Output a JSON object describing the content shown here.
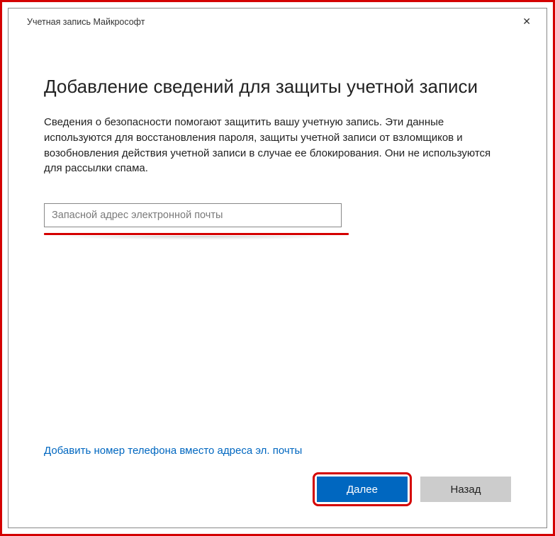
{
  "window": {
    "title": "Учетная запись Майкрософт"
  },
  "page": {
    "heading": "Добавление сведений для защиты учетной записи",
    "description": "Сведения о безопасности помогают защитить вашу учетную запись. Эти данные используются для восстановления пароля, защиты учетной записи от взломщиков и возобновления действия учетной записи в случае ее блокирования. Они не используются для рассылки спама."
  },
  "form": {
    "email_placeholder": "Запасной адрес электронной почты",
    "email_value": "",
    "phone_link": "Добавить номер телефона вместо адреса эл. почты"
  },
  "buttons": {
    "next": "Далее",
    "back": "Назад"
  }
}
